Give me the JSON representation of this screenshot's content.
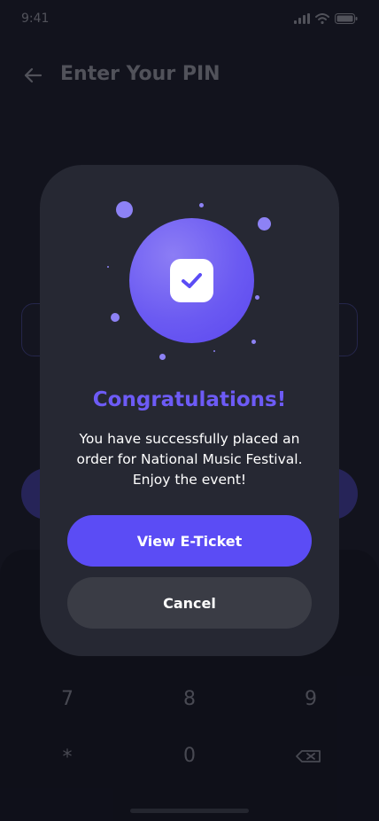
{
  "status_bar": {
    "time": "9:41"
  },
  "header": {
    "title": "Enter Your PIN"
  },
  "keypad": {
    "keys": [
      "7",
      "8",
      "9",
      "*",
      "0"
    ]
  },
  "dialog": {
    "title": "Congratulations!",
    "message": "You have successfully placed an order for National Music Festival. Enjoy the event!",
    "primary_button": "View E-Ticket",
    "secondary_button": "Cancel"
  },
  "colors": {
    "accent": "#5b4cf5",
    "title": "#6d5bf6",
    "dialog_bg": "#262833",
    "page_bg": "#181a27"
  },
  "icons": [
    "back-arrow-icon",
    "signal-icon",
    "wifi-icon",
    "battery-icon",
    "check-icon",
    "backspace-icon"
  ]
}
